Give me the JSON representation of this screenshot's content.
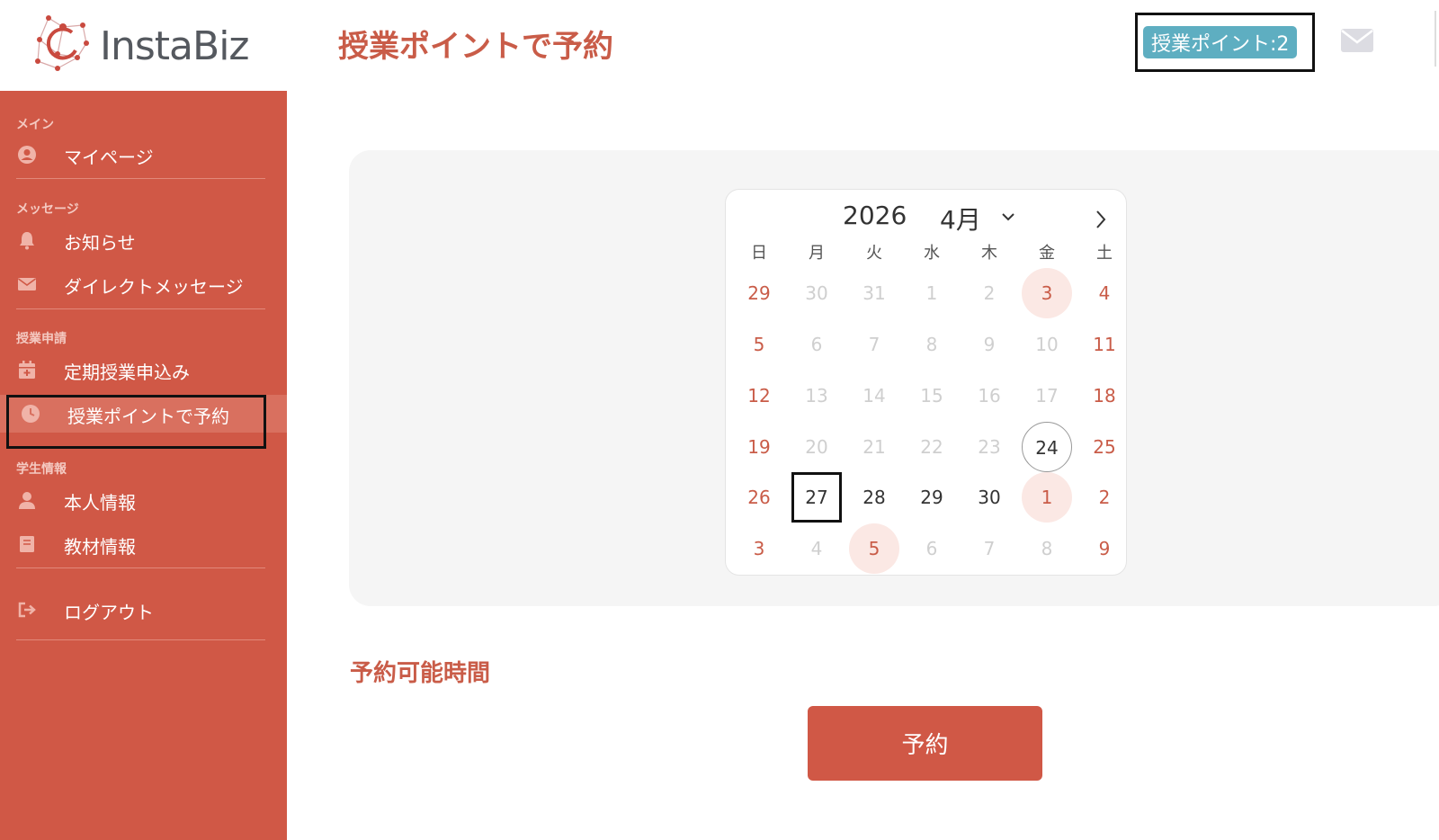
{
  "header": {
    "logo_text": "InstaBiz",
    "page_title": "授業ポイントで予約",
    "points_badge": "授業ポイント:2",
    "mail_icon": "envelope-icon"
  },
  "colors": {
    "brand": "#d05846",
    "accent_text": "#c95c48",
    "badge": "#5eaec1"
  },
  "sidebar": {
    "sections": [
      {
        "label": "メイン",
        "items": [
          {
            "label": "マイページ",
            "icon": "user-circle-icon"
          }
        ]
      },
      {
        "label": "メッセージ",
        "items": [
          {
            "label": "お知らせ",
            "icon": "bell-icon"
          },
          {
            "label": "ダイレクトメッセージ",
            "icon": "envelope-icon"
          }
        ]
      },
      {
        "label": "授業申請",
        "items": [
          {
            "label": "定期授業申込み",
            "icon": "calendar-plus-icon"
          },
          {
            "label": "授業ポイントで予約",
            "icon": "clock-icon",
            "active": true
          }
        ]
      },
      {
        "label": "学生情報",
        "items": [
          {
            "label": "本人情報",
            "icon": "user-icon"
          },
          {
            "label": "教材情報",
            "icon": "book-icon"
          }
        ]
      },
      {
        "label": "",
        "items": [
          {
            "label": "ログアウト",
            "icon": "sign-out-icon"
          }
        ]
      }
    ]
  },
  "calendar": {
    "year": "2026",
    "month": "4月",
    "weekdays": [
      "日",
      "月",
      "火",
      "水",
      "木",
      "金",
      "土"
    ],
    "weeks": [
      [
        {
          "d": "29",
          "s": "sunsat"
        },
        {
          "d": "30",
          "s": "disabled"
        },
        {
          "d": "31",
          "s": "disabled"
        },
        {
          "d": "1",
          "s": "disabled"
        },
        {
          "d": "2",
          "s": "disabled"
        },
        {
          "d": "3",
          "s": "holiday"
        },
        {
          "d": "4",
          "s": "sunsat"
        }
      ],
      [
        {
          "d": "5",
          "s": "sunsat"
        },
        {
          "d": "6",
          "s": "disabled"
        },
        {
          "d": "7",
          "s": "disabled"
        },
        {
          "d": "8",
          "s": "disabled"
        },
        {
          "d": "9",
          "s": "disabled"
        },
        {
          "d": "10",
          "s": "disabled"
        },
        {
          "d": "11",
          "s": "sunsat"
        }
      ],
      [
        {
          "d": "12",
          "s": "sunsat"
        },
        {
          "d": "13",
          "s": "disabled"
        },
        {
          "d": "14",
          "s": "disabled"
        },
        {
          "d": "15",
          "s": "disabled"
        },
        {
          "d": "16",
          "s": "disabled"
        },
        {
          "d": "17",
          "s": "disabled"
        },
        {
          "d": "18",
          "s": "sunsat"
        }
      ],
      [
        {
          "d": "19",
          "s": "sunsat"
        },
        {
          "d": "20",
          "s": "disabled"
        },
        {
          "d": "21",
          "s": "disabled"
        },
        {
          "d": "22",
          "s": "disabled"
        },
        {
          "d": "23",
          "s": "disabled"
        },
        {
          "d": "24",
          "s": "today"
        },
        {
          "d": "25",
          "s": "sunsat"
        }
      ],
      [
        {
          "d": "26",
          "s": "sunsat"
        },
        {
          "d": "27",
          "s": "selected"
        },
        {
          "d": "28",
          "s": "normal"
        },
        {
          "d": "29",
          "s": "normal"
        },
        {
          "d": "30",
          "s": "normal"
        },
        {
          "d": "1",
          "s": "holiday"
        },
        {
          "d": "2",
          "s": "sunsat"
        }
      ],
      [
        {
          "d": "3",
          "s": "sunsat"
        },
        {
          "d": "4",
          "s": "disabled"
        },
        {
          "d": "5",
          "s": "holiday"
        },
        {
          "d": "6",
          "s": "disabled"
        },
        {
          "d": "7",
          "s": "disabled"
        },
        {
          "d": "8",
          "s": "disabled"
        },
        {
          "d": "9",
          "s": "sunsat"
        }
      ]
    ]
  },
  "main": {
    "available_title": "予約可能時間",
    "reserve_button": "予約"
  }
}
